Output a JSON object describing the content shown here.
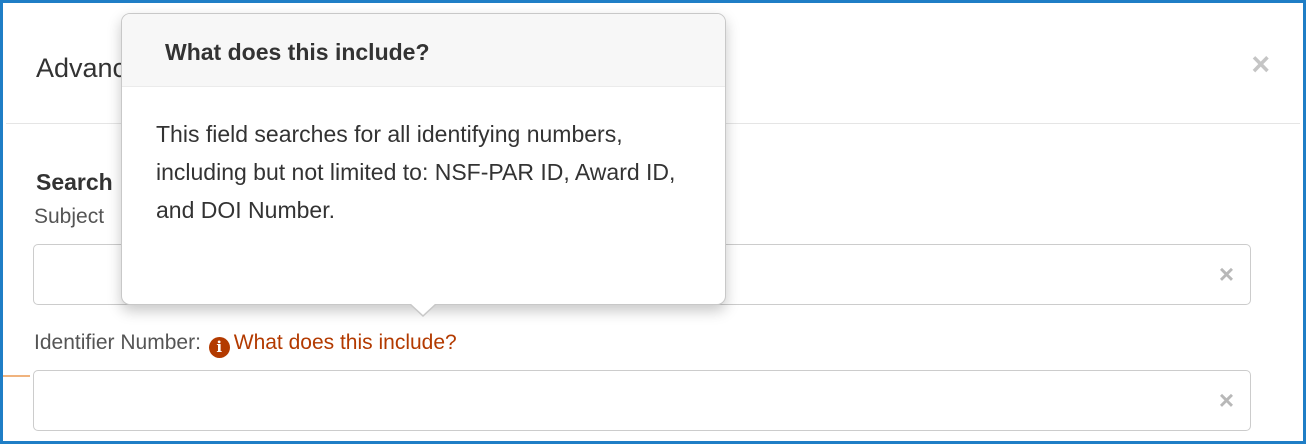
{
  "modal": {
    "title": "Advanced Search",
    "close_symbol": "×"
  },
  "form": {
    "section_heading": "Search",
    "subject_label": "Subject",
    "subject_value": "",
    "identifier_label": "Identifier Number:",
    "info_link_text": "What does this include?",
    "info_icon": "info-circle-icon",
    "identifier_value": "",
    "clear_symbol": "×"
  },
  "popover": {
    "title": "What does this include?",
    "content": "This field searches for all identifying numbers, including but not limited to: NSF-PAR ID, Award ID, and DOI Number."
  },
  "colors": {
    "frame_border": "#1f7ec6",
    "link": "#b33a00"
  }
}
